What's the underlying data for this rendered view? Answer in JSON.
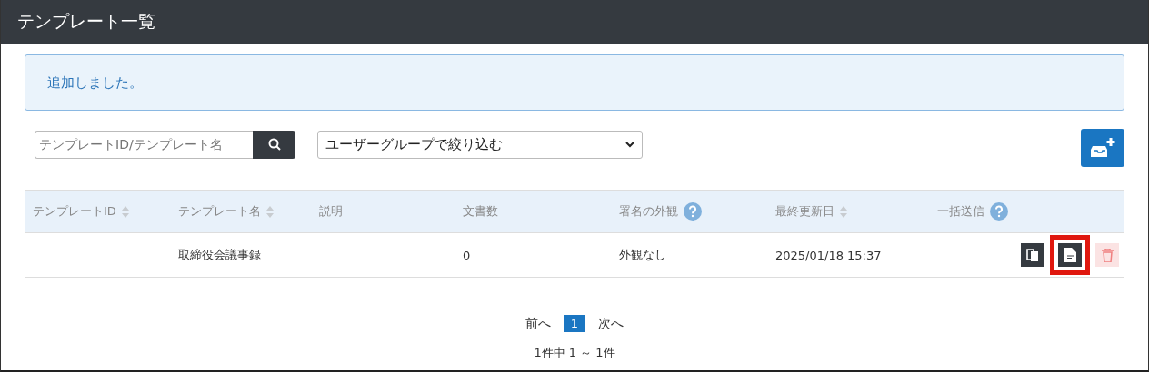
{
  "window": {
    "title": "テンプレート一覧"
  },
  "alert": {
    "message": "追加しました。"
  },
  "search": {
    "placeholder": "テンプレートID/テンプレート名"
  },
  "filter": {
    "value": "ユーザーグループで絞り込む"
  },
  "table": {
    "columns": [
      {
        "label": "テンプレートID",
        "sortable": true,
        "help": false
      },
      {
        "label": "テンプレート名",
        "sortable": true,
        "help": false
      },
      {
        "label": "説明",
        "sortable": false,
        "help": false
      },
      {
        "label": "文書数",
        "sortable": false,
        "help": false
      },
      {
        "label": "署名の外観",
        "sortable": false,
        "help": true
      },
      {
        "label": "最終更新日",
        "sortable": true,
        "help": false
      },
      {
        "label": "一括送信",
        "sortable": false,
        "help": true
      }
    ],
    "rows": [
      {
        "cells": [
          "",
          "取締役会議事録",
          "",
          "0",
          "外観なし",
          "2025/01/18 15:37",
          ""
        ],
        "actions": [
          {
            "kind": "copy",
            "highlighted": false
          },
          {
            "kind": "template",
            "highlighted": true
          },
          {
            "kind": "delete",
            "highlighted": false
          }
        ]
      }
    ]
  },
  "pagination": {
    "prev": "前へ",
    "pages": [
      {
        "label": "1",
        "selected": true
      }
    ],
    "next": "次へ",
    "summary": "1件中 1 ～ 1件"
  }
}
